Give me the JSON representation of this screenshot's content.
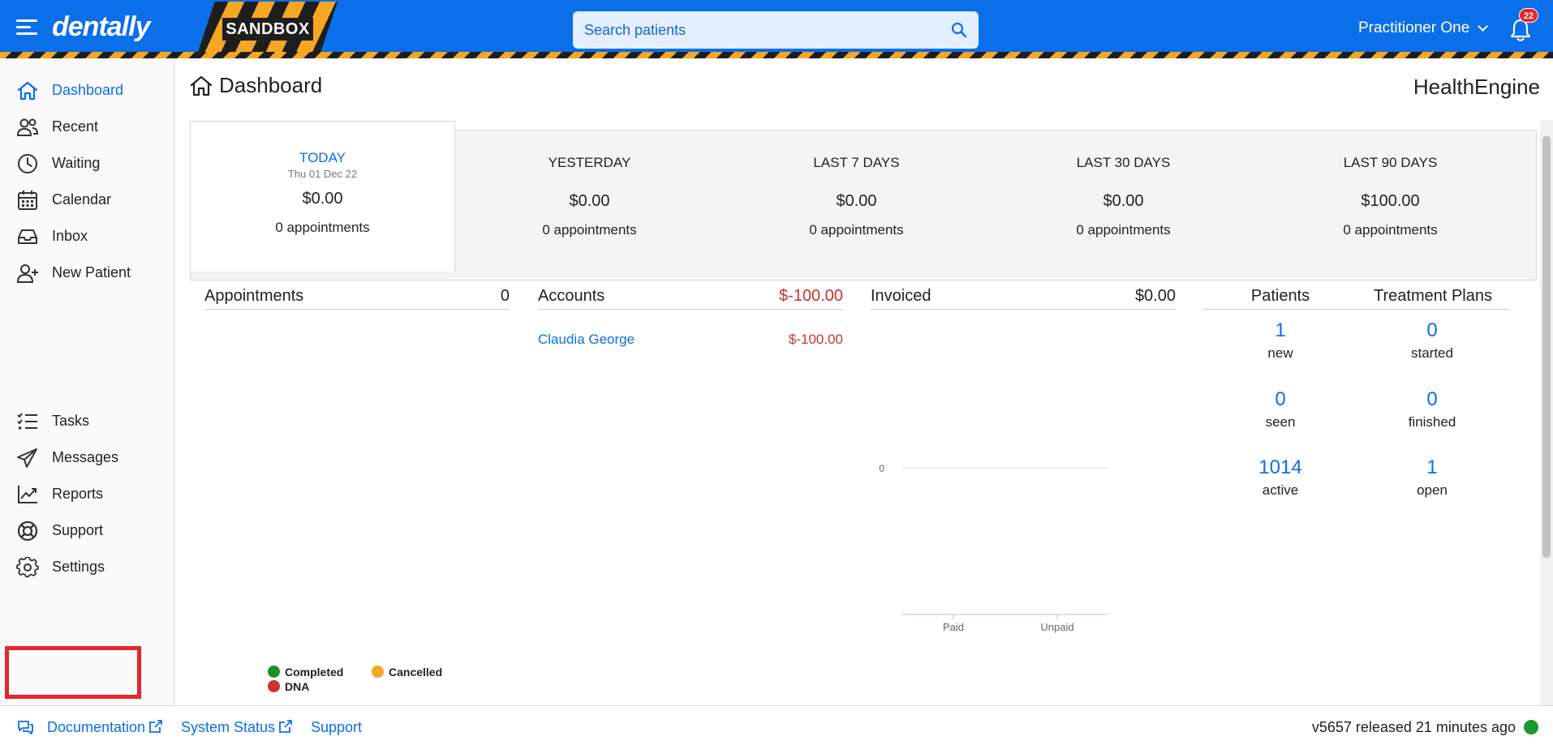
{
  "header": {
    "logo": "dentally",
    "environment_label": "SANDBOX",
    "search_placeholder": "Search patients",
    "user_name": "Practitioner One",
    "notification_count": "22"
  },
  "sidebar": {
    "items": [
      {
        "label": "Dashboard",
        "icon": "home-icon"
      },
      {
        "label": "Recent",
        "icon": "users-icon"
      },
      {
        "label": "Waiting",
        "icon": "clock-icon"
      },
      {
        "label": "Calendar",
        "icon": "calendar-icon"
      },
      {
        "label": "Inbox",
        "icon": "inbox-icon"
      },
      {
        "label": "New Patient",
        "icon": "user-plus-icon"
      },
      {
        "label": "Tasks",
        "icon": "tasks-icon"
      },
      {
        "label": "Messages",
        "icon": "paper-plane-icon"
      },
      {
        "label": "Reports",
        "icon": "chart-line-icon"
      },
      {
        "label": "Support",
        "icon": "lifebuoy-icon"
      },
      {
        "label": "Settings",
        "icon": "gear-icon"
      }
    ],
    "active": "Dashboard"
  },
  "page": {
    "title": "Dashboard",
    "brand": "HealthEngine"
  },
  "periods": [
    {
      "label": "TODAY",
      "date": "Thu 01 Dec 22",
      "amount": "$0.00",
      "appointments": "0 appointments"
    },
    {
      "label": "YESTERDAY",
      "amount": "$0.00",
      "appointments": "0 appointments"
    },
    {
      "label": "LAST 7 DAYS",
      "amount": "$0.00",
      "appointments": "0 appointments"
    },
    {
      "label": "LAST 30 DAYS",
      "amount": "$0.00",
      "appointments": "0 appointments"
    },
    {
      "label": "LAST 90 DAYS",
      "amount": "$100.00",
      "appointments": "0 appointments"
    }
  ],
  "appointments_panel": {
    "title": "Appointments",
    "count": "0",
    "legend": [
      "Completed",
      "Cancelled",
      "DNA"
    ],
    "legend_colors": [
      "#1a8f2a",
      "#f5a623",
      "#d0312d"
    ]
  },
  "accounts_panel": {
    "title": "Accounts",
    "total": "$-100.00",
    "rows": [
      {
        "name": "Claudia George",
        "amount": "$-100.00"
      }
    ]
  },
  "invoiced_panel": {
    "title": "Invoiced",
    "total": "$0.00",
    "chart_data": {
      "type": "bar",
      "categories": [
        "Paid",
        "Unpaid"
      ],
      "values": [
        0,
        0
      ],
      "y_tick_labels": [
        "0"
      ],
      "grid": true
    }
  },
  "patients_panel": {
    "title": "Patients",
    "stats": [
      {
        "value": "1",
        "label": "new"
      },
      {
        "value": "0",
        "label": "seen"
      },
      {
        "value": "1014",
        "label": "active"
      }
    ]
  },
  "treatment_panel": {
    "title": "Treatment Plans",
    "stats": [
      {
        "value": "0",
        "label": "started"
      },
      {
        "value": "0",
        "label": "finished"
      },
      {
        "value": "1",
        "label": "open"
      }
    ]
  },
  "footer": {
    "documentation": "Documentation",
    "system_status": "System Status",
    "support": "Support",
    "version": "v5657 released 21 minutes ago"
  }
}
